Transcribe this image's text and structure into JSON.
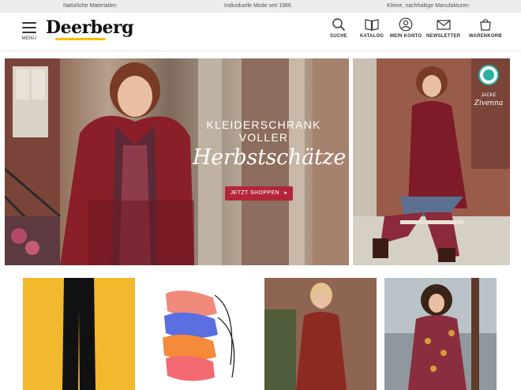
{
  "topbar": {
    "left": "Natürliche Materialien",
    "center": "Individuelle Mode seit 1986",
    "right": "Kleine, nachhaltige Manufakturen"
  },
  "header": {
    "menu_label": "MENU",
    "logo": "Deerberg",
    "nav": [
      {
        "label": "SUCHE",
        "icon": "search-icon"
      },
      {
        "label": "KATALOG",
        "icon": "catalog-icon"
      },
      {
        "label": "MEIN KONTO",
        "icon": "account-icon"
      },
      {
        "label": "NEWSLETTER",
        "icon": "mail-icon"
      },
      {
        "label": "WARENKORB",
        "icon": "bag-icon"
      }
    ]
  },
  "hero": {
    "line1": "KLEIDERSCHRANK",
    "line2": "VOLLER",
    "script": "Herbstschätze",
    "cta": "JETZT SHOPPEN",
    "cta_arrow": "▸",
    "accent_color": "#b3263a"
  },
  "side_banner": {
    "label": "JACKE",
    "name": "Zivenna",
    "badge_color": "#2bb0a4"
  },
  "products": [
    {
      "name": "leggings-product",
      "bg": "#f2b82e"
    },
    {
      "name": "face-masks-product",
      "bg": "#ffffff"
    },
    {
      "name": "red-dress-product",
      "bg": "#9b6b52"
    },
    {
      "name": "patterned-dress-product",
      "bg": "#9fa9b0"
    }
  ]
}
